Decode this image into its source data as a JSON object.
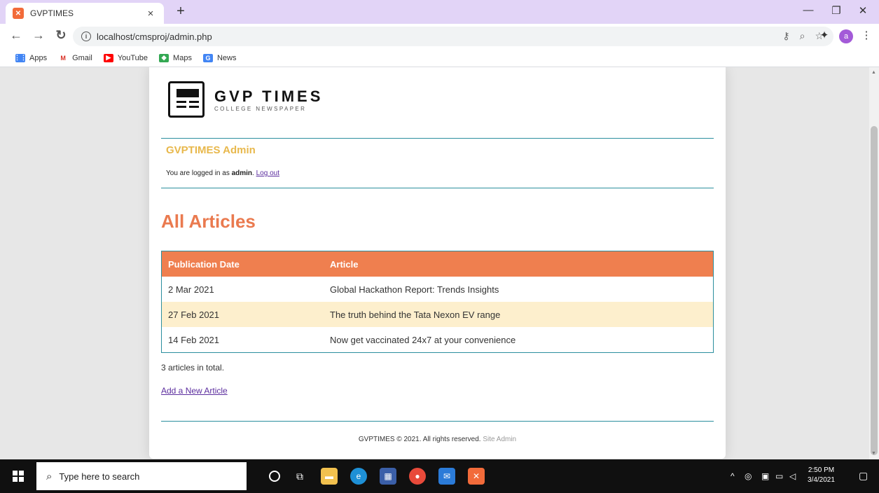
{
  "browser": {
    "tab_title": "GVPTIMES",
    "tab_close": "×",
    "new_tab": "+",
    "url": "localhost/cmsproj/admin.php",
    "profile_initial": "a",
    "bookmarks": [
      "Apps",
      "Gmail",
      "YouTube",
      "Maps",
      "News"
    ]
  },
  "logo": {
    "name": "GVP TIMES",
    "tagline": "COLLEGE NEWSPAPER"
  },
  "admin": {
    "title": "GVPTIMES Admin",
    "logged_prefix": "You are logged in as ",
    "username": "admin",
    "logged_suffix": ". ",
    "logout": "Log out"
  },
  "articles": {
    "heading": "All Articles",
    "col_date": "Publication Date",
    "col_article": "Article",
    "rows": [
      {
        "date": "2 Mar 2021",
        "title": "Global Hackathon Report: Trends Insights"
      },
      {
        "date": "27 Feb 2021",
        "title": "The truth behind the Tata Nexon EV range"
      },
      {
        "date": "14 Feb 2021",
        "title": "Now get vaccinated 24x7 at your convenience"
      }
    ],
    "total": "3 articles in total.",
    "add_link": "Add a New Article"
  },
  "footer": {
    "text": "GVPTIMES © 2021. All rights reserved. ",
    "site_admin": "Site Admin"
  },
  "taskbar": {
    "search_placeholder": "Type here to search",
    "time": "2:50 PM",
    "date": "3/4/2021"
  },
  "colors": {
    "accent_orange": "#ef7f4f",
    "heading_orange": "#ea7a4f",
    "admin_gold": "#e8b84c",
    "rule_teal": "#2b8f9e",
    "alt_row": "#fdefcd"
  }
}
